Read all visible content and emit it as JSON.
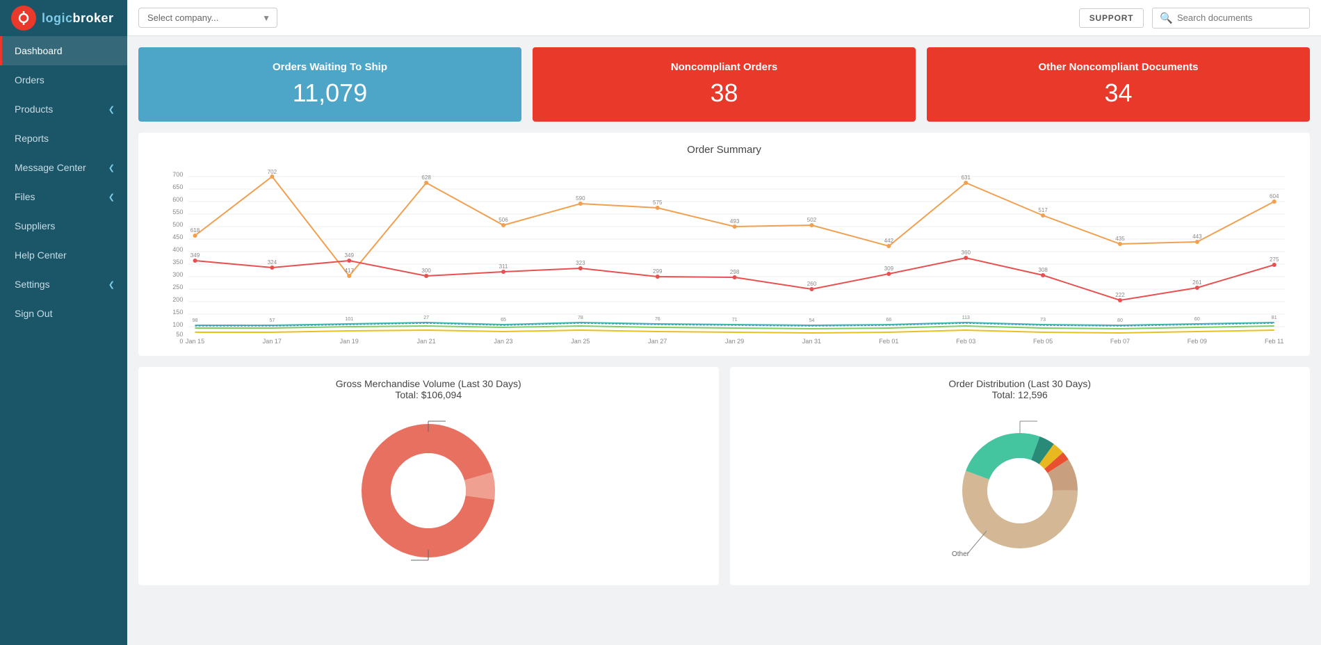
{
  "sidebar": {
    "logo_brand": "logic",
    "logo_accent": "broker",
    "nav_items": [
      {
        "id": "dashboard",
        "label": "Dashboard",
        "active": true,
        "has_chevron": false
      },
      {
        "id": "orders",
        "label": "Orders",
        "active": false,
        "has_chevron": false
      },
      {
        "id": "products",
        "label": "Products",
        "active": false,
        "has_chevron": true
      },
      {
        "id": "reports",
        "label": "Reports",
        "active": false,
        "has_chevron": false
      },
      {
        "id": "message-center",
        "label": "Message Center",
        "active": false,
        "has_chevron": true
      },
      {
        "id": "files",
        "label": "Files",
        "active": false,
        "has_chevron": true
      },
      {
        "id": "suppliers",
        "label": "Suppliers",
        "active": false,
        "has_chevron": false
      },
      {
        "id": "help-center",
        "label": "Help Center",
        "active": false,
        "has_chevron": false
      },
      {
        "id": "settings",
        "label": "Settings",
        "active": false,
        "has_chevron": true
      },
      {
        "id": "sign-out",
        "label": "Sign Out",
        "active": false,
        "has_chevron": false
      }
    ]
  },
  "topbar": {
    "company_placeholder": "Select company...",
    "support_label": "SUPPORT",
    "search_placeholder": "Search documents"
  },
  "kpi": {
    "cards": [
      {
        "id": "waiting-to-ship",
        "title": "Orders Waiting To Ship",
        "value": "11,079",
        "color": "blue"
      },
      {
        "id": "noncompliant-orders",
        "title": "Noncompliant Orders",
        "value": "38",
        "color": "red"
      },
      {
        "id": "noncompliant-docs",
        "title": "Other Noncompliant Documents",
        "value": "34",
        "color": "red"
      }
    ]
  },
  "order_summary": {
    "title": "Order Summary",
    "x_labels": [
      "Jan 15",
      "Jan 17",
      "Jan 19",
      "Jan 21",
      "Jan 23",
      "Jan 25",
      "Jan 27",
      "Jan 29",
      "Jan 31",
      "Feb 01",
      "Feb 03",
      "Feb 05",
      "Feb 07",
      "Feb 09",
      "Feb 11"
    ],
    "y_labels": [
      "0",
      "50",
      "100",
      "150",
      "200",
      "250",
      "300",
      "350",
      "400",
      "450",
      "500",
      "550",
      "600",
      "650",
      "700"
    ]
  },
  "gmv": {
    "title": "Gross Merchandise Volume (Last 30 Days)",
    "subtitle": "Total: $106,094"
  },
  "order_dist": {
    "title": "Order Distribution (Last 30 Days)",
    "subtitle": "Total: 12,596",
    "other_label": "Other"
  }
}
